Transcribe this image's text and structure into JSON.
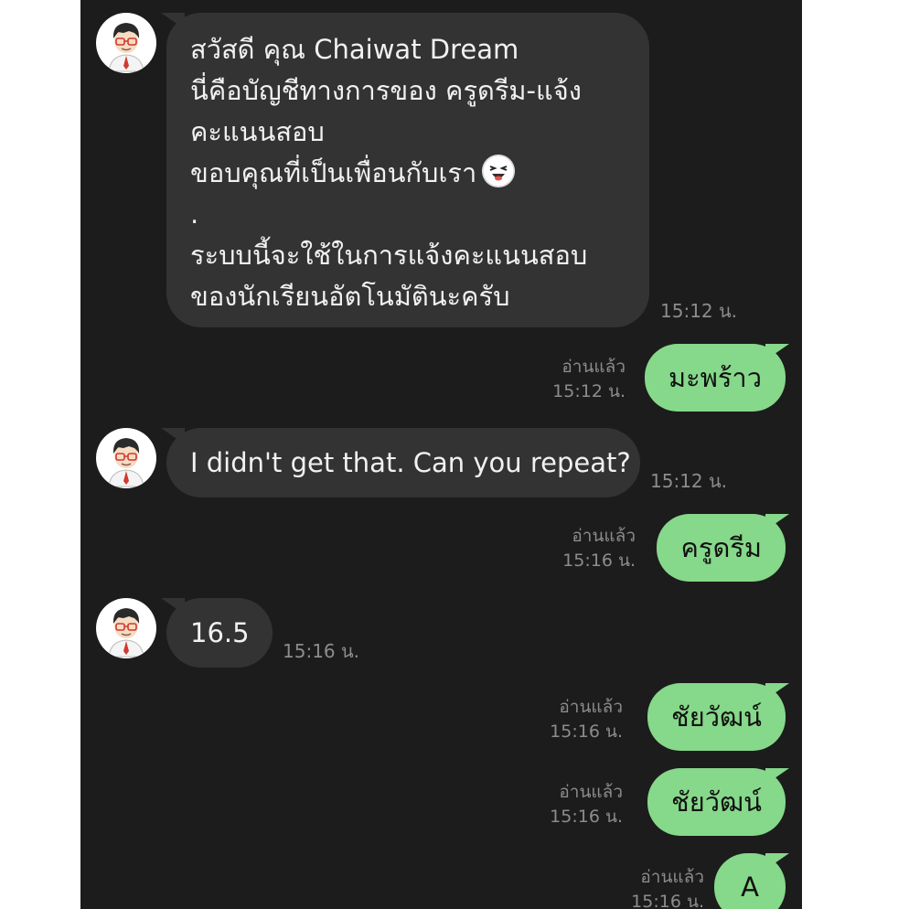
{
  "messages": [
    {
      "sender": "bot",
      "lines": [
        "สวัสดี คุณ Chaiwat Dream",
        "นี่คือบัญชีทางการของ ครูดรีม-แจ้ง",
        "คะแนนสอบ",
        "ขอบคุณที่เป็นเพื่อนกับเรา",
        ".",
        "ระบบนี้จะใช้ในการแจ้งคะแนนสอบ",
        "ของนักเรียนอัตโนมัตินะครับ"
      ],
      "emoji": "laughing-face-emoji",
      "time": "15:12 น."
    },
    {
      "sender": "me",
      "text": "มะพร้าว",
      "read": "อ่านแล้ว",
      "time": "15:12 น."
    },
    {
      "sender": "bot",
      "text": "I didn't get that. Can you repeat?",
      "time": "15:12 น."
    },
    {
      "sender": "me",
      "text": "ครูดรีม",
      "read": "อ่านแล้ว",
      "time": "15:16 น."
    },
    {
      "sender": "bot",
      "text": "16.5",
      "time": "15:16 น."
    },
    {
      "sender": "me",
      "text": "ชัยวัฒน์",
      "read": "อ่านแล้ว",
      "time": "15:16 น."
    },
    {
      "sender": "me",
      "text": "ชัยวัฒน์",
      "read": "อ่านแล้ว",
      "time": "15:16 น."
    },
    {
      "sender": "me",
      "text": "A",
      "read": "อ่านแล้ว",
      "time": "15:16 น."
    }
  ],
  "colors": {
    "background": "#1c1c1c",
    "incoming_bubble": "#333334",
    "outgoing_bubble": "#86d88a",
    "meta_text": "#8c8c8c"
  },
  "icons": {
    "avatar": "teacher-avatar-icon"
  }
}
